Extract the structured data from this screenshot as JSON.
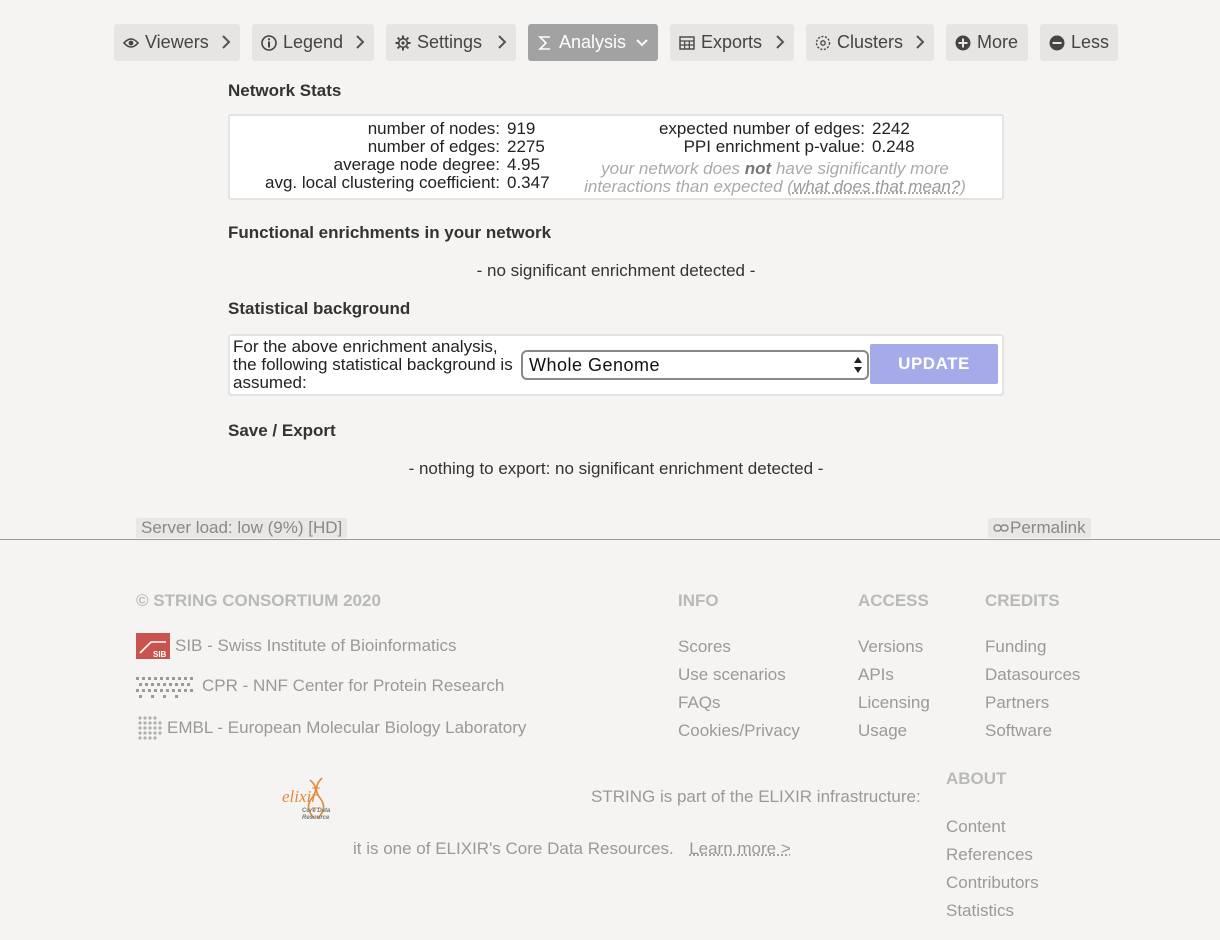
{
  "tabs": [
    {
      "label": "Viewers",
      "icon": "eye-icon",
      "chevron": "right"
    },
    {
      "label": "Legend",
      "icon": "info-icon",
      "chevron": "right"
    },
    {
      "label": "Settings",
      "icon": "gear-icon",
      "chevron": "right"
    },
    {
      "label": "Analysis",
      "icon": "sigma-icon",
      "chevron": "down",
      "active": true
    },
    {
      "label": "Exports",
      "icon": "table-icon",
      "chevron": "right"
    },
    {
      "label": "Clusters",
      "icon": "clusters-icon",
      "chevron": "right"
    },
    {
      "label": "More",
      "icon": "plus-circle-icon"
    },
    {
      "label": "Less",
      "icon": "minus-circle-icon"
    }
  ],
  "network_stats": {
    "title": "Network Stats",
    "nodes_label": "number of nodes:",
    "nodes": "919",
    "edges_label": "number of edges:",
    "edges": "2275",
    "degree_label": "average node degree:",
    "degree": "4.95",
    "clustering_label": "avg. local clustering coefficient:",
    "clustering": "0.347",
    "expected_label": "expected number of edges:",
    "expected": "2242",
    "pvalue_label": "PPI enrichment p-value:",
    "pvalue": "0.248",
    "note_pre": "your network does ",
    "note_bold": "not",
    "note_mid": " have significantly more interactions than expected (",
    "note_link": "what does that mean?",
    "note_post": ")"
  },
  "enrichment": {
    "title": "Functional enrichments in your network",
    "message": "- no significant enrichment detected -"
  },
  "background": {
    "title": "Statistical background",
    "text": "For the above enrichment analysis, the following statistical background is assumed:",
    "selected": "Whole Genome",
    "button": "UPDATE"
  },
  "save_export": {
    "title": "Save / Export",
    "message": "- nothing to export: no significant enrichment detected -"
  },
  "status": {
    "server_load": "Server load: low (9%) [HD]",
    "permalink": "Permalink"
  },
  "footer": {
    "copyright": "© STRING CONSORTIUM 2020",
    "institutions": [
      "SIB - Swiss Institute of Bioinformatics",
      "CPR - NNF Center for Protein Research",
      "EMBL - European Molecular Biology Laboratory"
    ],
    "sib_logo_text": "SIB",
    "info": {
      "title": "INFO",
      "links": [
        "Scores",
        "Use scenarios",
        "FAQs",
        "Cookies/Privacy"
      ]
    },
    "access": {
      "title": "ACCESS",
      "links": [
        "Versions",
        "APIs",
        "Licensing",
        "Usage"
      ]
    },
    "credits": {
      "title": "CREDITS",
      "links": [
        "Funding",
        "Datasources",
        "Partners",
        "Software"
      ]
    },
    "about": {
      "title": "ABOUT",
      "links": [
        "Content",
        "References",
        "Contributors",
        "Statistics"
      ]
    },
    "elixir_logo_text": "elixir",
    "elixir_logo_sub": "Core Data Resource",
    "elixir_line1": "STRING is part of the ELIXIR infrastructure:",
    "elixir_line2": "it is one of ELIXIR's Core Data Resources.",
    "learn_more": "Learn more >"
  },
  "colors": {
    "update_button": "#a5abe8",
    "active_tab": "#a2a2a2",
    "background": "#f5f4f2"
  }
}
